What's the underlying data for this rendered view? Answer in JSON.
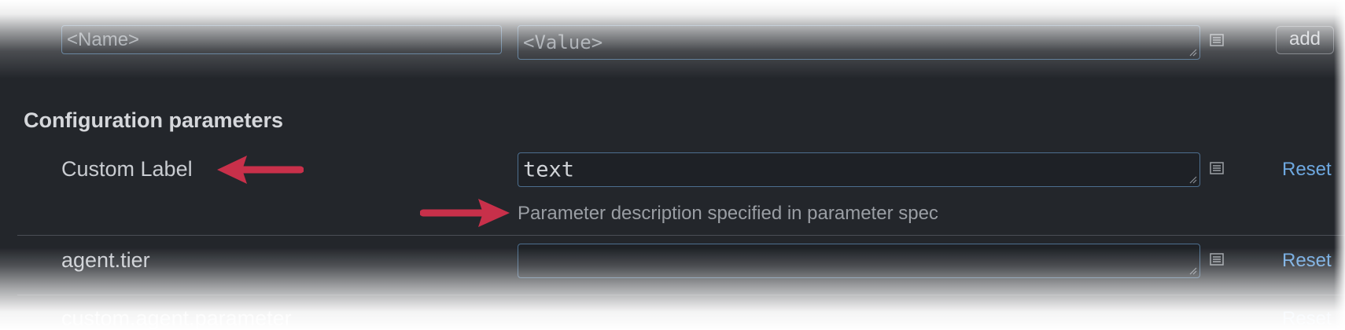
{
  "add_row": {
    "name_placeholder": "<Name>",
    "value_placeholder": "<Value>",
    "add_label": "add",
    "list_icon": "list-icon"
  },
  "section": {
    "title": "Configuration parameters"
  },
  "params": [
    {
      "label": "Custom Label",
      "value": "text",
      "description": "Parameter description specified in parameter spec",
      "reset_label": "Reset",
      "list_icon": "list-icon"
    },
    {
      "label": "agent.tier",
      "value": "",
      "reset_label": "Reset",
      "list_icon": "list-icon"
    },
    {
      "label": "custom.agent.parameter",
      "reset_label": "Reset"
    }
  ],
  "colors": {
    "panel_bg": "#23262b",
    "field_border": "#4d6f8f",
    "link": "#6ea8e0",
    "annotation_arrow": "#c8304a"
  }
}
